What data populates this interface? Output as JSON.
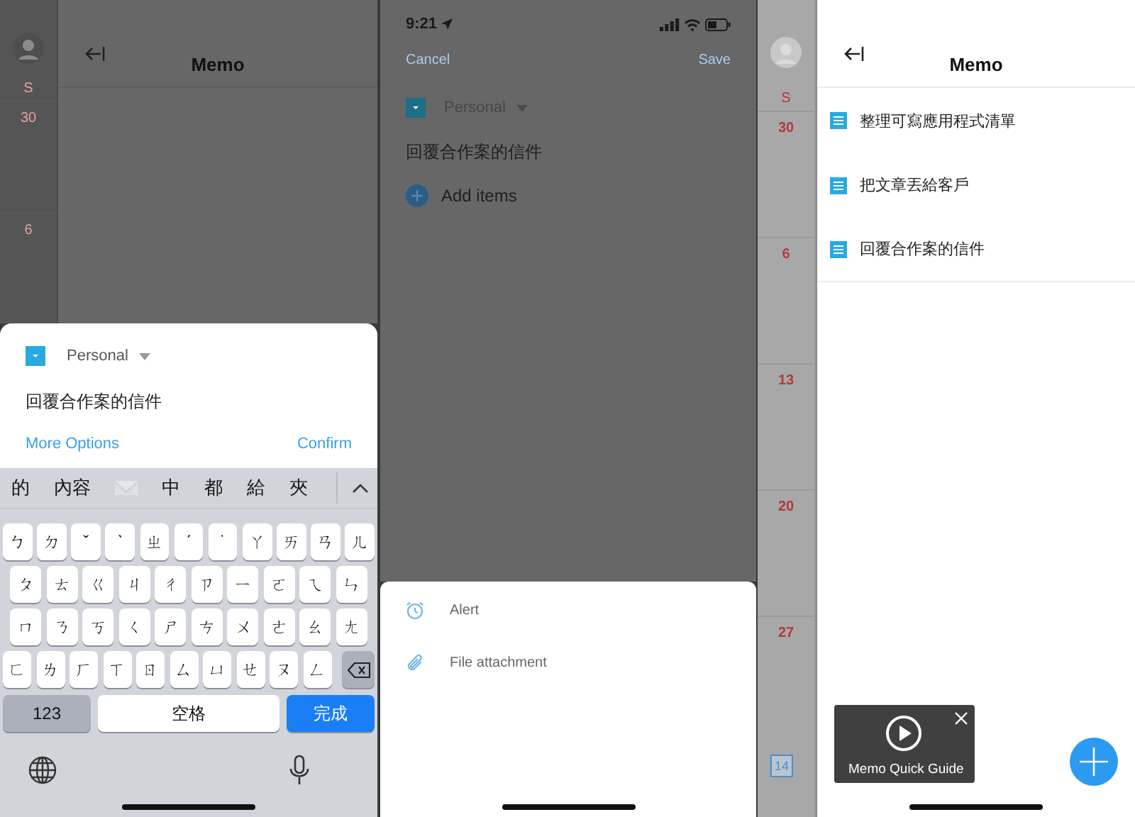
{
  "screen_1": {
    "calendar_strip": {
      "weekday": "S",
      "dates": [
        "30",
        "6"
      ]
    },
    "header": {
      "title": "Memo"
    },
    "sheet": {
      "category": "Personal",
      "title_field": {
        "value": "回覆合作案的信件"
      },
      "more_options": "More Options",
      "confirm": "Confirm"
    },
    "keyboard": {
      "candidates": [
        "的",
        "內容",
        "中",
        "都",
        "給",
        "夾"
      ],
      "rows": [
        [
          "ㄅ",
          "ㄉ",
          "ˇ",
          "ˋ",
          "ㄓ",
          "ˊ",
          "˙",
          "ㄚ",
          "ㄞ",
          "ㄢ",
          "ㄦ"
        ],
        [
          "ㄆ",
          "ㄊ",
          "ㄍ",
          "ㄐ",
          "ㄔ",
          "ㄗ",
          "ㄧ",
          "ㄛ",
          "ㄟ",
          "ㄣ"
        ],
        [
          "ㄇ",
          "ㄋ",
          "ㄎ",
          "ㄑ",
          "ㄕ",
          "ㄘ",
          "ㄨ",
          "ㄜ",
          "ㄠ",
          "ㄤ"
        ],
        [
          "ㄈ",
          "ㄌ",
          "ㄏ",
          "ㄒ",
          "ㄖ",
          "ㄙ",
          "ㄩ",
          "ㄝ",
          "ㄡ",
          "ㄥ"
        ]
      ],
      "numbers_key": "123",
      "space_key": "空格",
      "done_key": "完成"
    }
  },
  "screen_2": {
    "status_bar": {
      "time": "9:21"
    },
    "cancel": "Cancel",
    "save": "Save",
    "category": "Personal",
    "title": "回覆合作案的信件",
    "add_items": "Add items",
    "options": [
      {
        "kind": "alert",
        "label": "Alert"
      },
      {
        "kind": "attachment",
        "label": "File attachment"
      }
    ]
  },
  "screen_3": {
    "calendar_strip": {
      "weekday": "S",
      "dates": [
        "30",
        "6",
        "13",
        "20",
        "27"
      ],
      "today": "14"
    },
    "header": {
      "title": "Memo"
    },
    "memos": [
      "整理可寫應用程式清單",
      "把文章丟給客戶",
      "回覆合作案的信件"
    ],
    "video": {
      "caption": "Memo Quick Guide"
    }
  }
}
